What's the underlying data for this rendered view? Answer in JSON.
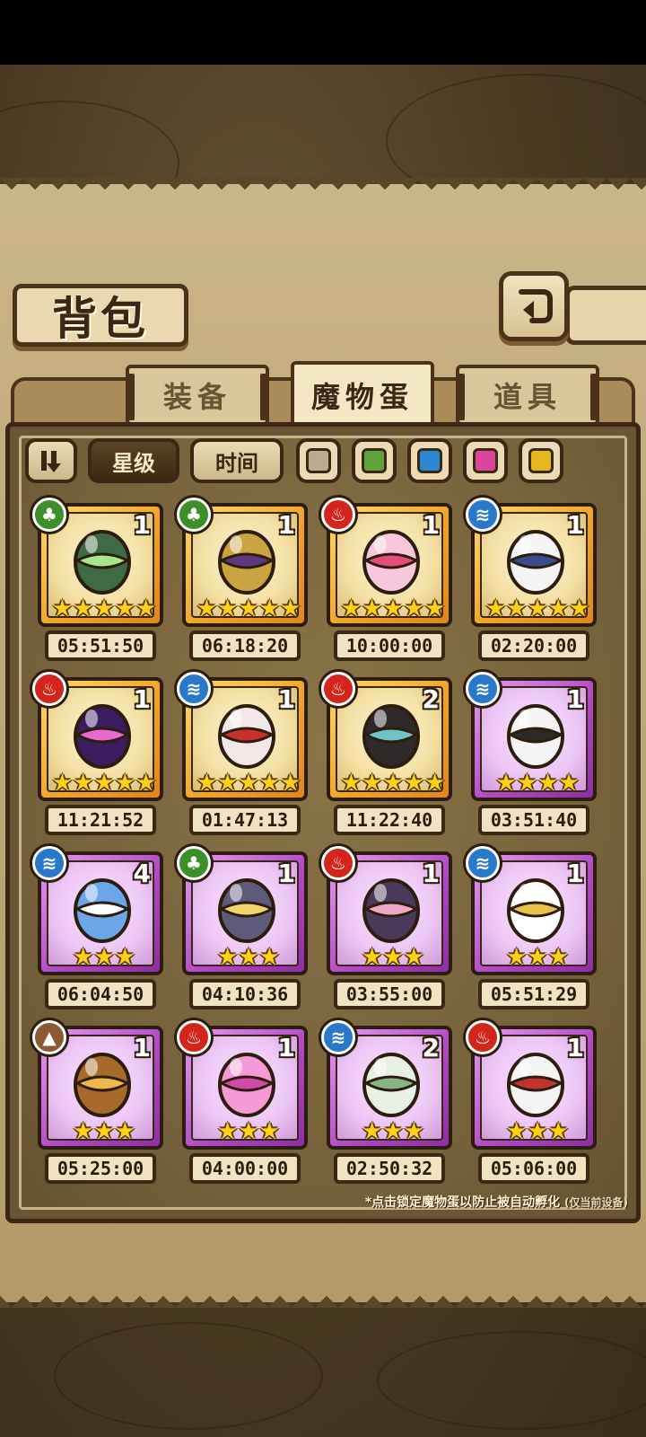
{
  "header": {
    "title": "背包",
    "back_icon": "return-arrow-icon"
  },
  "tabs": [
    {
      "label": "装备",
      "active": false
    },
    {
      "label": "魔物蛋",
      "active": true
    },
    {
      "label": "道具",
      "active": false
    }
  ],
  "filters": {
    "sort_icon": "sort-toggle-icon",
    "star_label": "星级",
    "time_label": "时间",
    "colors": [
      {
        "name": "gray",
        "hex": "#b8ab90"
      },
      {
        "name": "green",
        "hex": "#5fa23a"
      },
      {
        "name": "blue",
        "hex": "#2f86d1"
      },
      {
        "name": "pink",
        "hex": "#d9469c"
      },
      {
        "name": "yellow",
        "hex": "#e2b81e"
      }
    ]
  },
  "eggs": [
    {
      "element": "grass",
      "rarity": "gold",
      "stars": 5,
      "qty": "1",
      "timer": "05:51:50",
      "icon": "green-cage-egg-icon"
    },
    {
      "element": "grass",
      "rarity": "gold",
      "stars": 5,
      "qty": "1",
      "timer": "06:18:20",
      "icon": "magic-lamp-egg-icon"
    },
    {
      "element": "fire",
      "rarity": "gold",
      "stars": 5,
      "qty": "1",
      "timer": "10:00:00",
      "icon": "pink-cake-egg-icon"
    },
    {
      "element": "water",
      "rarity": "gold",
      "stars": 5,
      "qty": "1",
      "timer": "02:20:00",
      "icon": "frilled-egg-icon"
    },
    {
      "element": "fire",
      "rarity": "gold",
      "stars": 5,
      "qty": "1",
      "timer": "11:21:52",
      "icon": "vortex-orb-egg-icon"
    },
    {
      "element": "water",
      "rarity": "gold",
      "stars": 5,
      "qty": "1",
      "timer": "01:47:13",
      "icon": "spotted-nest-egg-icon"
    },
    {
      "element": "fire",
      "rarity": "gold",
      "stars": 5,
      "qty": "2",
      "timer": "11:22:40",
      "icon": "pirate-hat-egg-icon"
    },
    {
      "element": "water",
      "rarity": "purple",
      "stars": 4,
      "qty": "1",
      "timer": "03:51:40",
      "icon": "panda-egg-icon"
    },
    {
      "element": "water",
      "rarity": "purple",
      "stars": 3,
      "qty": "4",
      "timer": "06:04:50",
      "icon": "cotton-flower-egg-icon"
    },
    {
      "element": "grass",
      "rarity": "purple",
      "stars": 3,
      "qty": "1",
      "timer": "04:10:36",
      "icon": "feather-wing-egg-icon"
    },
    {
      "element": "fire",
      "rarity": "purple",
      "stars": 3,
      "qty": "1",
      "timer": "03:55:00",
      "icon": "demon-mask-egg-icon"
    },
    {
      "element": "water",
      "rarity": "purple",
      "stars": 3,
      "qty": "1",
      "timer": "05:51:29",
      "icon": "angel-wing-egg-icon"
    },
    {
      "element": "earth",
      "rarity": "purple",
      "stars": 3,
      "qty": "1",
      "timer": "05:25:00",
      "icon": "furry-horn-egg-icon"
    },
    {
      "element": "fire",
      "rarity": "purple",
      "stars": 3,
      "qty": "1",
      "timer": "04:00:00",
      "icon": "pink-flame-egg-icon"
    },
    {
      "element": "water",
      "rarity": "purple",
      "stars": 3,
      "qty": "2",
      "timer": "02:50:32",
      "icon": "leaf-sprout-egg-icon"
    },
    {
      "element": "fire",
      "rarity": "purple",
      "stars": 3,
      "qty": "1",
      "timer": "05:06:00",
      "icon": "red-hood-egg-icon"
    }
  ],
  "footnote": {
    "main": "*点击锁定魔物蛋以防止被自动孵化",
    "sub": "(仅当前设备)"
  }
}
